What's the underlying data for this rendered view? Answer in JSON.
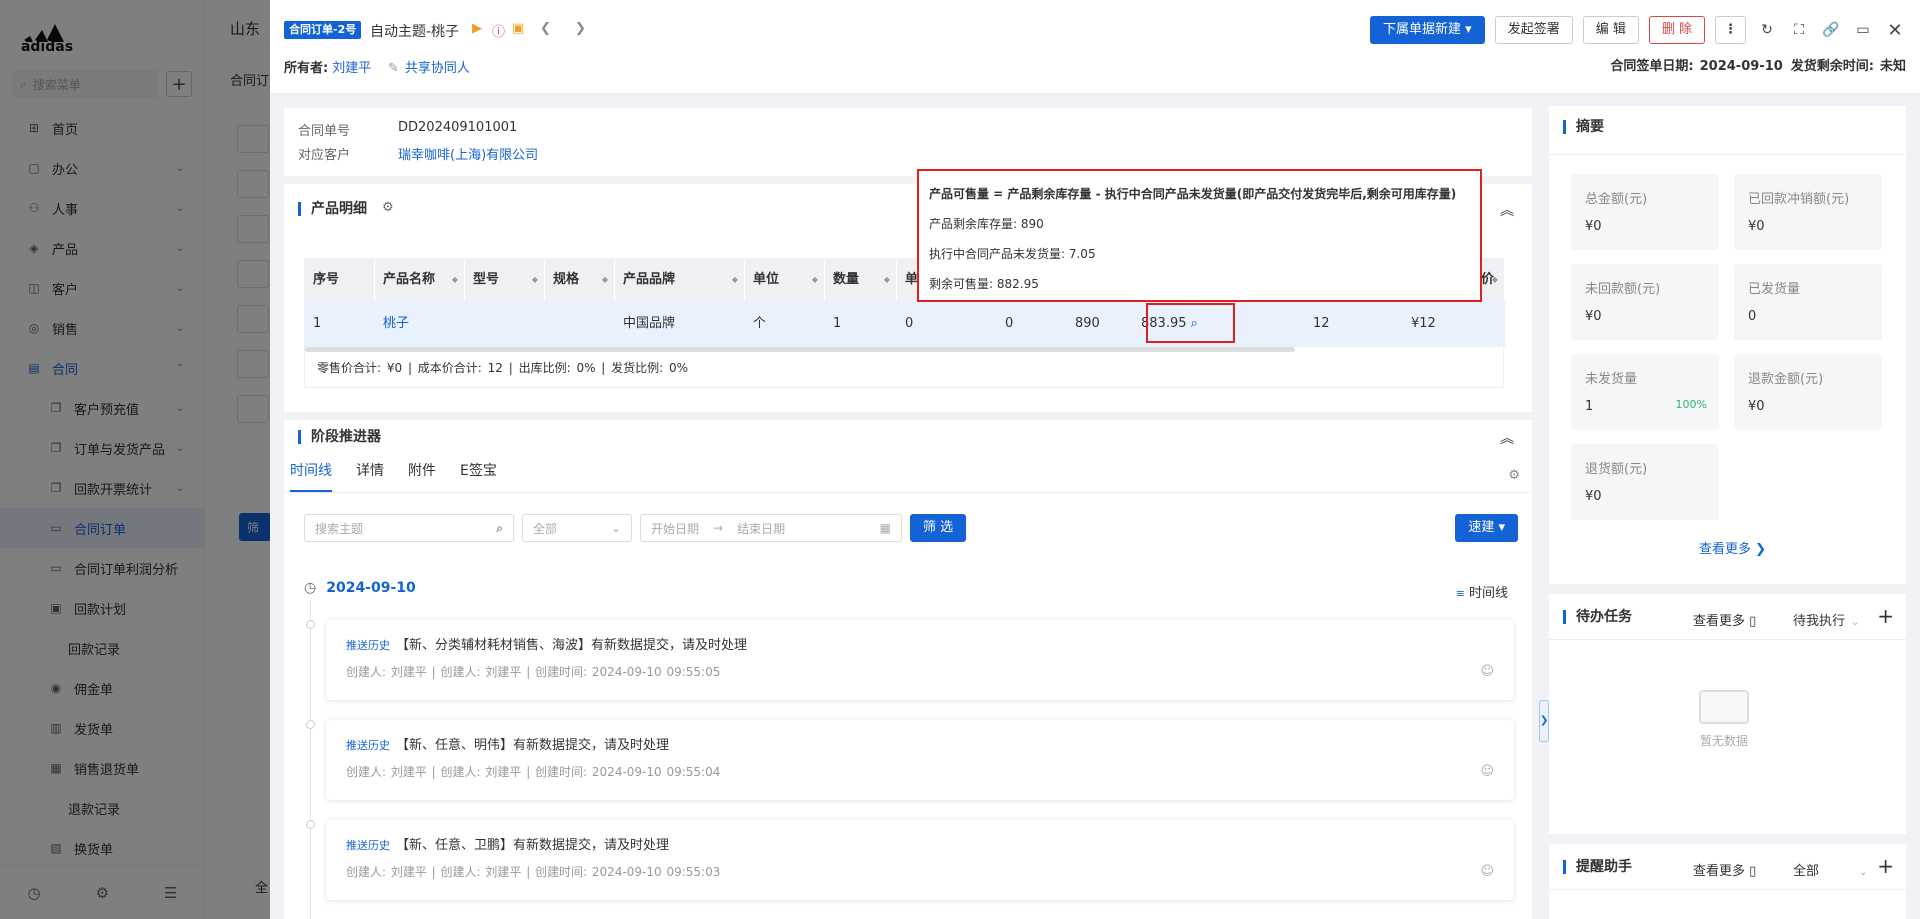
{
  "sidebar": {
    "brand": "adidas",
    "search_placeholder": "搜索菜单",
    "items": [
      {
        "label": "首页",
        "icon": "home-icon",
        "glyph": "⊞"
      },
      {
        "label": "办公",
        "icon": "office-icon",
        "glyph": "▢"
      },
      {
        "label": "人事",
        "icon": "people-icon",
        "glyph": "⚇"
      },
      {
        "label": "产品",
        "icon": "product-icon",
        "glyph": "◈"
      },
      {
        "label": "客户",
        "icon": "customer-icon",
        "glyph": "◫"
      },
      {
        "label": "销售",
        "icon": "sales-icon",
        "glyph": "◎"
      },
      {
        "label": "合同",
        "icon": "contract-icon",
        "glyph": "▤"
      },
      {
        "label": "客户预充值",
        "icon": "copy-icon",
        "glyph": "❐"
      },
      {
        "label": "订单与发货产品",
        "icon": "copy-icon",
        "glyph": "❐"
      },
      {
        "label": "回款开票统计",
        "icon": "copy-icon",
        "glyph": "❐"
      },
      {
        "label": "合同订单",
        "icon": "document-icon",
        "glyph": "▭"
      },
      {
        "label": "合同订单利润分析",
        "icon": "document-icon",
        "glyph": "▭"
      },
      {
        "label": "回款计划",
        "icon": "plan-icon",
        "glyph": "▣"
      },
      {
        "label": "回款记录",
        "icon": "",
        "glyph": ""
      },
      {
        "label": "佣金单",
        "icon": "commission-icon",
        "glyph": "◉"
      },
      {
        "label": "发货单",
        "icon": "ship-icon",
        "glyph": "▥"
      },
      {
        "label": "销售退货单",
        "icon": "return-icon",
        "glyph": "▦"
      },
      {
        "label": "退款记录",
        "icon": "",
        "glyph": ""
      },
      {
        "label": "换货单",
        "icon": "exchange-icon",
        "glyph": "▧"
      }
    ]
  },
  "bgpage": {
    "title": "山东",
    "tab": "合同订",
    "filter_btn": "筛",
    "bottom": "全"
  },
  "header": {
    "badge": "合同订单-2号",
    "title": "自动主题-桃子",
    "owner_label": "所有者:",
    "owner": "刘建平",
    "share": "共享协同人",
    "btn_new": "下属单据新建",
    "btn_sign": "发起签署",
    "btn_edit": "编 辑",
    "btn_delete": "删 除",
    "sign_date_label": "合同签单日期:",
    "sign_date": "2024-09-10",
    "remain_label": "发货剩余时间:",
    "remain": "未知"
  },
  "info": {
    "order_no_label": "合同单号",
    "order_no": "DD202409101001",
    "customer_label": "对应客户",
    "customer": "瑞幸咖啡(上海)有限公司"
  },
  "products": {
    "title": "产品明细",
    "columns": [
      "序号",
      "产品名称",
      "型号",
      "规格",
      "产品品牌",
      "单位",
      "数量",
      "单",
      "价"
    ],
    "row": {
      "no": "1",
      "name": "桃子",
      "model": "",
      "spec": "",
      "brand": "中国品牌",
      "unit": "个",
      "qty": "1",
      "c1": "0",
      "c2": "0",
      "stock": "890",
      "sellable": "883.95",
      "c3": "12",
      "price": "¥12"
    },
    "footer": "零售价合计: ¥0 |  成本价合计: 12 |  出库比例: 0% |  发货比例: 0%"
  },
  "tooltip": {
    "title": "产品可售量 = 产品剩余库存量 - 执行中合同产品未发货量(即产品交付发货完毕后,剩余可用库存量)",
    "line1": "产品剩余库存量: 890",
    "line2": "执行中合同产品未发货量: 7.05",
    "line3": "剩余可售量: 882.95"
  },
  "stage": {
    "title": "阶段推进器",
    "tabs": [
      "时间线",
      "详情",
      "附件",
      "E签宝"
    ],
    "search_placeholder": "搜索主题",
    "select_all": "全部",
    "start_date": "开始日期",
    "end_date": "结束日期",
    "filter_btn": "筛 选",
    "quick_btn": "速建",
    "date": "2024-09-10",
    "timeline_switch": "时间线",
    "items": [
      {
        "tag": "推送历史",
        "title": "【新、分类辅材耗材销售、海波】有新数据提交，请及时处理",
        "meta": "创建人: 刘建平  |  创建人: 刘建平  |  创建时间: 2024-09-10 09:55:05"
      },
      {
        "tag": "推送历史",
        "title": "【新、任意、明伟】有新数据提交，请及时处理",
        "meta": "创建人: 刘建平  |  创建人: 刘建平  |  创建时间: 2024-09-10 09:55:04"
      },
      {
        "tag": "推送历史",
        "title": "【新、任意、卫鹏】有新数据提交，请及时处理",
        "meta": "创建人: 刘建平  |  创建人: 刘建平  |  创建时间: 2024-09-10 09:55:03"
      }
    ]
  },
  "summary": {
    "title": "摘要",
    "cells": [
      {
        "label": "总金额(元)",
        "value": "¥0"
      },
      {
        "label": "已回款冲销额(元)",
        "value": "¥0"
      },
      {
        "label": "未回款额(元)",
        "value": "¥0"
      },
      {
        "label": "已发货量",
        "value": "0"
      },
      {
        "label": "未发货量",
        "value": "1",
        "pct": "100%"
      },
      {
        "label": "退款金额(元)",
        "value": "¥0"
      },
      {
        "label": "退货额(元)",
        "value": "¥0"
      }
    ],
    "view_more": "查看更多"
  },
  "todo": {
    "title": "待办任务",
    "view_more": "查看更多",
    "filter": "待我执行",
    "empty": "暂无数据"
  },
  "remind": {
    "title": "提醒助手",
    "view_more": "查看更多",
    "filter": "全部"
  }
}
